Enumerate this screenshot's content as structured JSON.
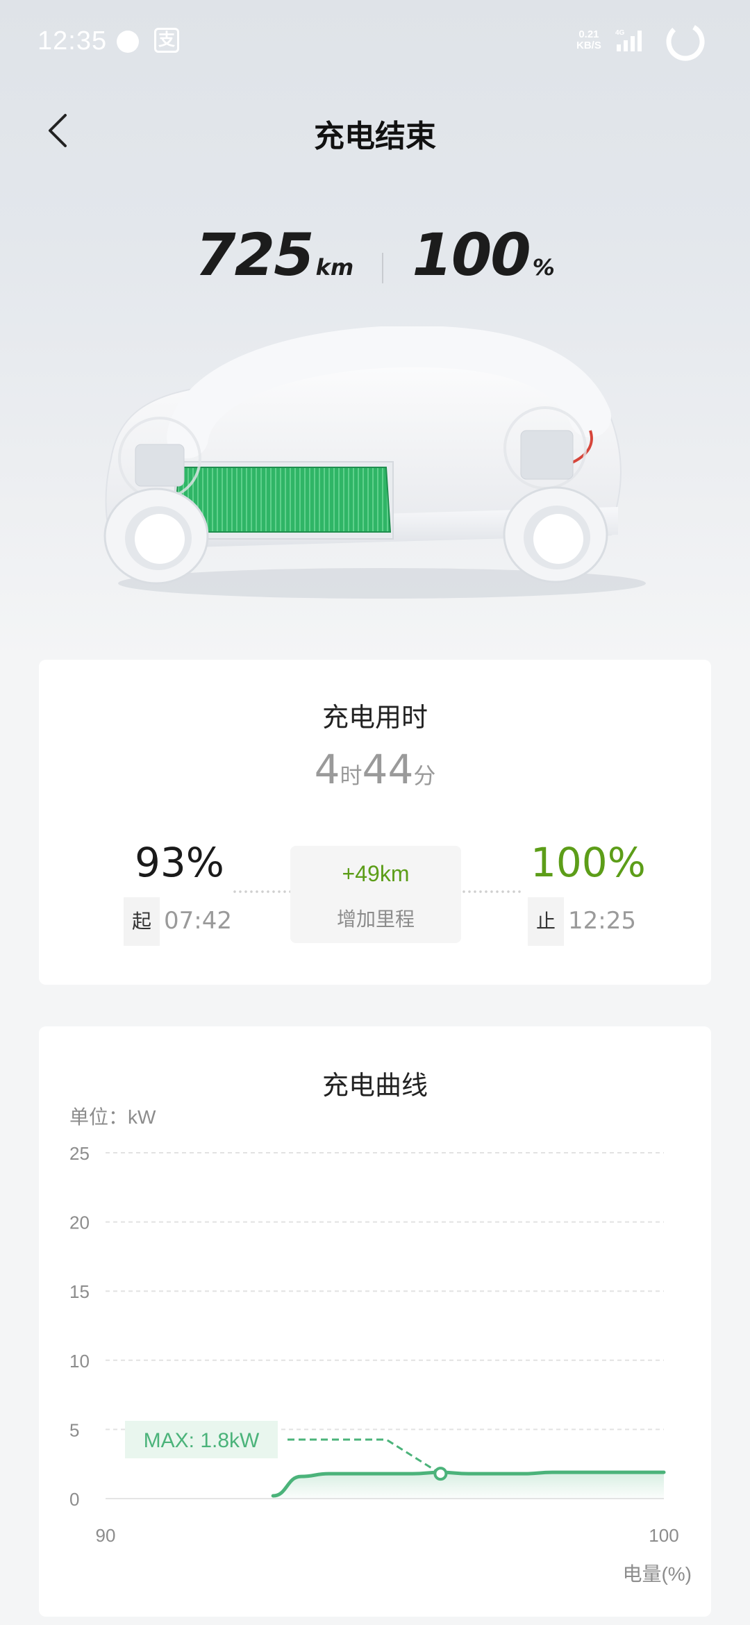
{
  "status_bar": {
    "time": "12:35",
    "app_badge": "支",
    "net_speed_value": "0.21",
    "net_speed_unit": "KB/S",
    "network": "4G"
  },
  "header": {
    "title": "充电结束"
  },
  "summary": {
    "range_value": "725",
    "range_unit": "km",
    "battery_value": "100",
    "battery_unit": "%",
    "battery_level": 1.0
  },
  "duration_card": {
    "title": "充电用时",
    "hours": "4",
    "hours_unit": "时",
    "minutes": "44",
    "minutes_unit": "分",
    "start_percent": "93%",
    "start_tag": "起",
    "start_time": "07:42",
    "added_range": "+49km",
    "added_label": "增加里程",
    "end_percent": "100%",
    "end_tag": "止",
    "end_time": "12:25"
  },
  "curve_card": {
    "title": "充电曲线",
    "unit_label": "单位：kW",
    "x_axis_label": "电量(%)",
    "max_label": "MAX: 1.8kW"
  },
  "colors": {
    "accent_green": "#5c9d18",
    "curve_green": "#4bb37a",
    "battery_green": "#2fb566"
  },
  "chart_data": {
    "type": "area",
    "xlabel": "电量(%)",
    "ylabel": "单位：kW",
    "xlim": [
      90,
      100
    ],
    "ylim": [
      0,
      25
    ],
    "y_ticks": [
      "0",
      "5",
      "10",
      "15",
      "20",
      "25"
    ],
    "x_ticks": [
      "90",
      "100"
    ],
    "grid": true,
    "x": [
      93,
      93.5,
      94,
      94.5,
      95,
      95.5,
      96,
      96.5,
      97,
      97.5,
      98,
      98.5,
      99,
      99.5,
      100
    ],
    "values": [
      0.2,
      1.6,
      1.8,
      1.8,
      1.8,
      1.8,
      1.9,
      1.8,
      1.8,
      1.8,
      1.9,
      1.9,
      1.9,
      1.9,
      1.9
    ],
    "max_point": {
      "x": 96,
      "y": 1.8
    },
    "annotations": [
      "MAX: 1.8kW"
    ]
  }
}
